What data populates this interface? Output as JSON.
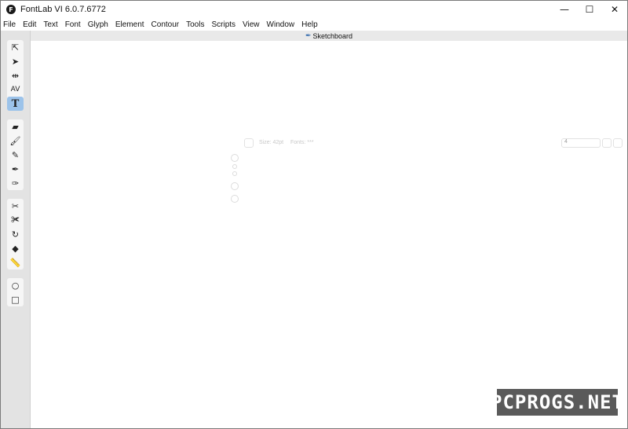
{
  "window": {
    "title": "FontLab VI 6.0.7.6772",
    "logo_letter": "F",
    "controls": {
      "minimize": "—",
      "maximize": "☐",
      "close": "✕"
    }
  },
  "menu": [
    "File",
    "Edit",
    "Text",
    "Font",
    "Glyph",
    "Element",
    "Contour",
    "Tools",
    "Scripts",
    "View",
    "Window",
    "Help"
  ],
  "tab": {
    "label": "Sketchboard",
    "icon": "pen-nib-icon"
  },
  "tools": {
    "group1": [
      {
        "name": "contour-select-icon",
        "glyph": "⇱"
      },
      {
        "name": "element-select-icon",
        "glyph": "➤"
      },
      {
        "name": "metrics-icon",
        "glyph": "⇹"
      },
      {
        "name": "kerning-icon",
        "glyph": "AV"
      },
      {
        "name": "text-icon",
        "glyph": "T"
      }
    ],
    "group2": [
      {
        "name": "eraser-icon",
        "glyph": "▰"
      },
      {
        "name": "brush-icon",
        "glyph": "🖌"
      },
      {
        "name": "pencil-icon",
        "glyph": "✎"
      },
      {
        "name": "pen-icon",
        "glyph": "✒"
      },
      {
        "name": "rapidograph-icon",
        "glyph": "✑"
      }
    ],
    "group3": [
      {
        "name": "knife-icon",
        "glyph": "✂"
      },
      {
        "name": "scissors-icon",
        "glyph": "✀"
      },
      {
        "name": "rotate-icon",
        "glyph": "↻"
      },
      {
        "name": "fill-icon",
        "glyph": "◆"
      },
      {
        "name": "ruler-icon",
        "glyph": "📏"
      }
    ],
    "group4": [
      {
        "name": "ellipse-icon",
        "glyph": "○"
      },
      {
        "name": "rectangle-icon",
        "glyph": "□"
      }
    ]
  },
  "canvas": {
    "size_label": "Size: 42pt",
    "fonts_label": "Fonts: ***",
    "zoom_value": "4"
  },
  "watermark": "PCPROGS.NET"
}
